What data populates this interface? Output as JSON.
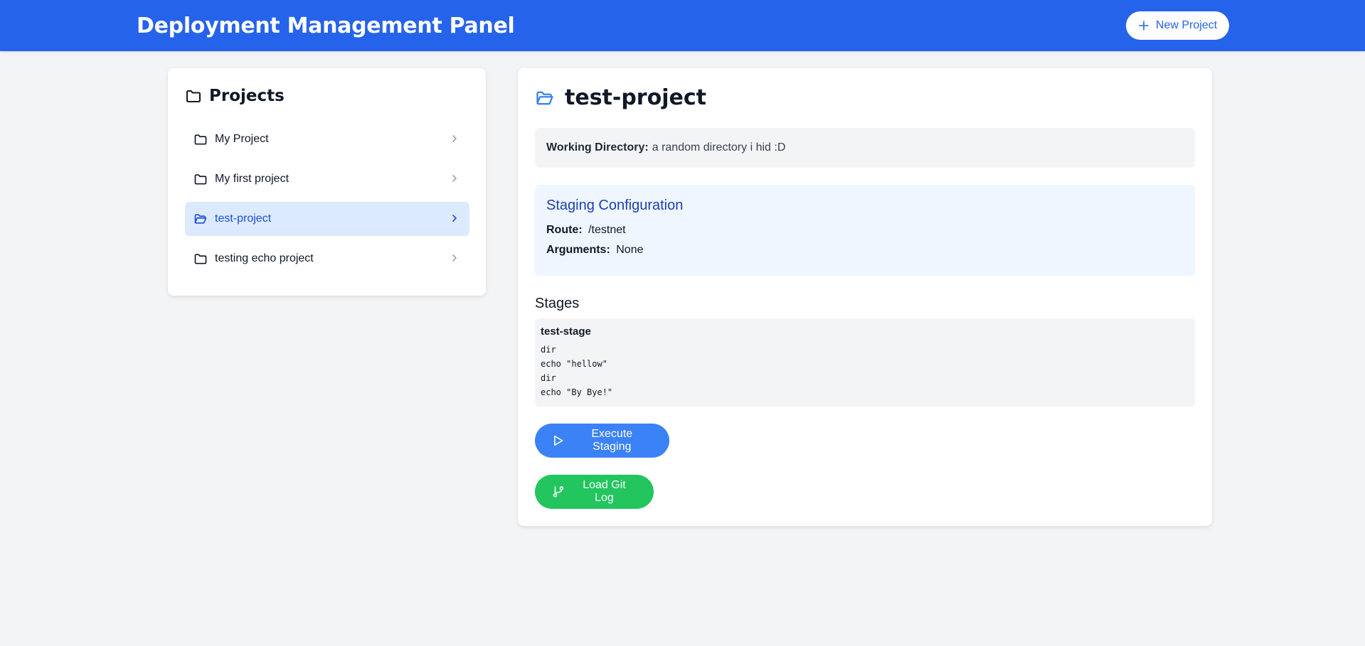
{
  "header": {
    "title": "Deployment Management Panel",
    "new_project_label": "New Project",
    "color": "#2563eb"
  },
  "sidebar": {
    "heading": "Projects",
    "items": [
      {
        "label": "My Project",
        "active": false
      },
      {
        "label": "My first project",
        "active": false
      },
      {
        "label": "test-project",
        "active": true
      },
      {
        "label": "testing echo project",
        "active": false
      }
    ]
  },
  "main": {
    "title": "test-project",
    "working_directory_label": "Working Directory:",
    "working_directory_value": "a random directory i hid :D",
    "staging": {
      "title": "Staging Configuration",
      "route_label": "Route:",
      "route_value": "/testnet",
      "arguments_label": "Arguments:",
      "arguments_value": "None"
    },
    "stages_heading": "Stages",
    "stages": [
      {
        "name": "test-stage",
        "commands": [
          "dir",
          "echo \"hellow\"",
          "dir",
          "echo \"By Bye!\""
        ]
      }
    ],
    "execute_label": "Execute Staging",
    "git_log_label": "Load Git Log"
  },
  "icons": {
    "new_project": "plus-icon",
    "projects": "folder-icon",
    "active_project": "folder-open-icon",
    "item_arrow": "chevron-right-icon",
    "execute": "play-icon",
    "git": "git-branch-icon"
  },
  "colors": {
    "active_bg": "#dbeafe",
    "execute": "#3b82f6",
    "git": "#22c55e"
  }
}
